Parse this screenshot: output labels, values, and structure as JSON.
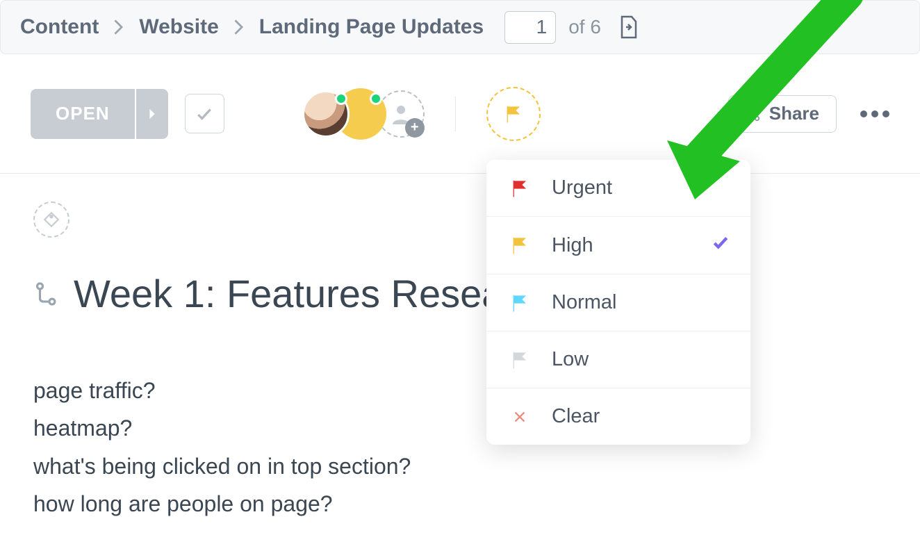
{
  "breadcrumb": {
    "items": [
      "Content",
      "Website",
      "Landing Page Updates"
    ],
    "page_current": "1",
    "page_total": "of 6"
  },
  "toolbar": {
    "open_label": "OPEN",
    "share_label": "Share"
  },
  "task": {
    "title": "Week 1: Features Resea",
    "body": [
      "page traffic?",
      "heatmap?",
      "what's being clicked on in top section?",
      "how long are people on page?"
    ]
  },
  "priority": {
    "options": [
      {
        "label": "Urgent",
        "color": "#e22f2f",
        "selected": false
      },
      {
        "label": "High",
        "color": "#f2c33c",
        "selected": true
      },
      {
        "label": "Normal",
        "color": "#5fd7ff",
        "selected": false
      },
      {
        "label": "Low",
        "color": "#d3d7dc",
        "selected": false
      }
    ],
    "clear_label": "Clear"
  }
}
